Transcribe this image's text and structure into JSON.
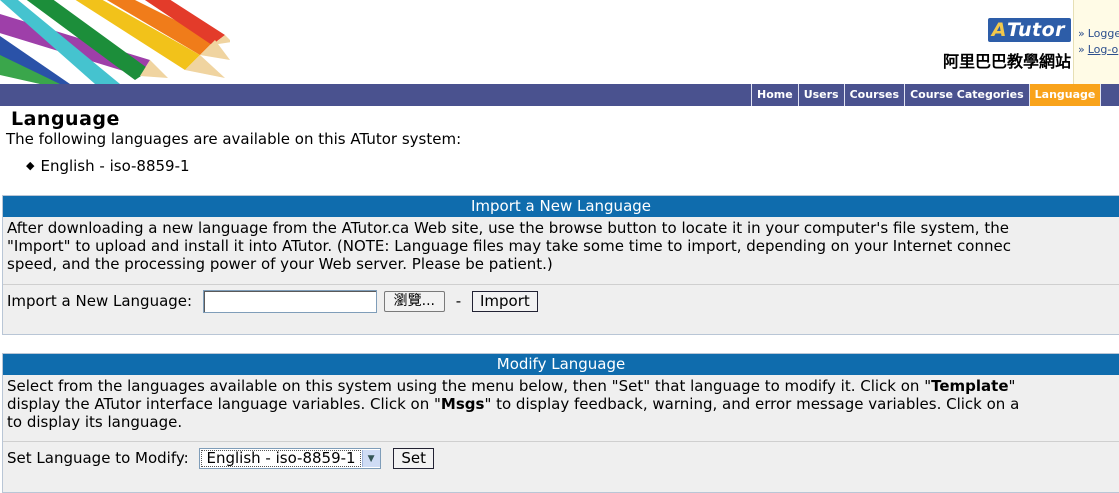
{
  "header": {
    "logo_text_a": "A",
    "logo_text_tutor": "Tutor",
    "site_name": "阿里巴巴教學網站",
    "user_links": [
      "Logge",
      "Log-o"
    ]
  },
  "nav": {
    "tabs": [
      "Home",
      "Users",
      "Courses",
      "Course Categories",
      "Language"
    ],
    "active": "Language"
  },
  "page": {
    "title": "Language",
    "intro": "The following languages are available on this ATutor system:",
    "languages": [
      "English - iso-8859-1"
    ]
  },
  "import_panel": {
    "heading": "Import a New Language",
    "description": [
      "After downloading a new language from the ATutor.ca Web site, use the browse button to locate it in your computer's file system, the",
      "\"Import\" to upload and install it into ATutor. (NOTE: Language files may take some time to import, depending on your Internet connec",
      "speed, and the processing power of your Web server. Please be patient.)"
    ],
    "field_label": "Import a New Language",
    "browse_label": "瀏覽...",
    "separator": "-",
    "import_button": "Import"
  },
  "modify_panel": {
    "heading": "Modify Language",
    "description_1a": "Select from the languages available on this system using the menu below, then \"Set\" that language to modify it. Click on \"",
    "description_1b": "Template",
    "description_1c": "\"",
    "description_2a": "display the ATutor interface language variables. Click on \"",
    "description_2b": "Msgs",
    "description_2c": "\" to display feedback, warning, and error message variables. Click on a",
    "description_3": "to display its language.",
    "field_label": "Set Language to Modify",
    "selected_language": "English - iso-8859-1",
    "set_button": "Set"
  }
}
